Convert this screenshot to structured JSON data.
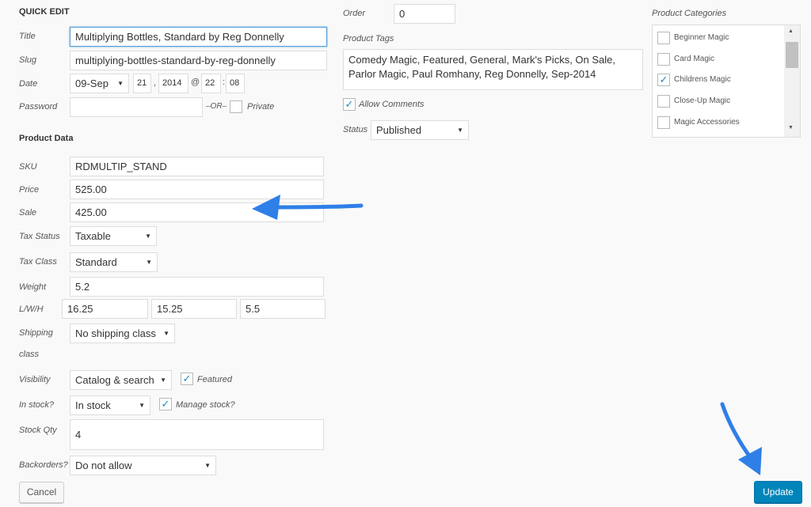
{
  "quick_edit": {
    "heading": "QUICK EDIT",
    "title_label": "Title",
    "title_value": "Multiplying Bottles, Standard by Reg Donnelly",
    "slug_label": "Slug",
    "slug_value": "multiplying-bottles-standard-by-reg-donnelly",
    "date_label": "Date",
    "date_month": "09-Sep",
    "date_day": "21",
    "date_year": "2014",
    "date_hour": "22",
    "date_minute": "08",
    "date_comma": ",",
    "date_at": "@",
    "date_colon": ":",
    "password_label": "Password",
    "password_value": "",
    "or_label": "–OR–",
    "private_label": "Private",
    "private_checked": false
  },
  "product_data": {
    "heading": "Product Data",
    "sku_label": "SKU",
    "sku_value": "RDMULTIP_STAND",
    "price_label": "Price",
    "price_value": "525.00",
    "sale_label": "Sale",
    "sale_value": "425.00",
    "tax_status_label": "Tax Status",
    "tax_status_value": "Taxable",
    "tax_class_label": "Tax Class",
    "tax_class_value": "Standard",
    "weight_label": "Weight",
    "weight_value": "5.2",
    "lwh_label": "L/W/H",
    "length_value": "16.25",
    "width_value": "15.25",
    "height_value": "5.5",
    "shipping_label_1": "Shipping",
    "shipping_label_2": "class",
    "shipping_value": "No shipping class",
    "visibility_label": "Visibility",
    "visibility_value": "Catalog & search",
    "featured_label": "Featured",
    "featured_checked": true,
    "in_stock_label": "In stock?",
    "in_stock_value": "In stock",
    "manage_stock_label": "Manage stock?",
    "manage_stock_checked": true,
    "stock_qty_label": "Stock Qty",
    "stock_qty_value": "4",
    "backorders_label": "Backorders?",
    "backorders_value": "Do not allow"
  },
  "middle": {
    "order_label": "Order",
    "order_value": "0",
    "tags_label": "Product Tags",
    "tags_value": "Comedy Magic, Featured, General, Mark's Picks, On Sale, Parlor Magic, Paul Romhany, Reg Donnelly, Sep-2014",
    "allow_comments_label": "Allow Comments",
    "allow_comments_checked": true,
    "status_label": "Status",
    "status_value": "Published"
  },
  "categories": {
    "label": "Product Categories",
    "items": [
      {
        "label": "Beginner Magic",
        "checked": false
      },
      {
        "label": "Card Magic",
        "checked": false
      },
      {
        "label": "Childrens Magic",
        "checked": true
      },
      {
        "label": "Close-Up Magic",
        "checked": false
      },
      {
        "label": "Magic Accessories",
        "checked": false
      }
    ]
  },
  "buttons": {
    "cancel": "Cancel",
    "update": "Update"
  },
  "icons": {
    "select_arrow": "▼",
    "checkmark": "✓",
    "scroll_up": "▲",
    "scroll_down": "▼",
    "annotation_arrow": "arrow-icon"
  },
  "colors": {
    "accent": "#0085ba",
    "annotation_arrow": "#2f7fe8",
    "check": "#1e8cbe"
  }
}
